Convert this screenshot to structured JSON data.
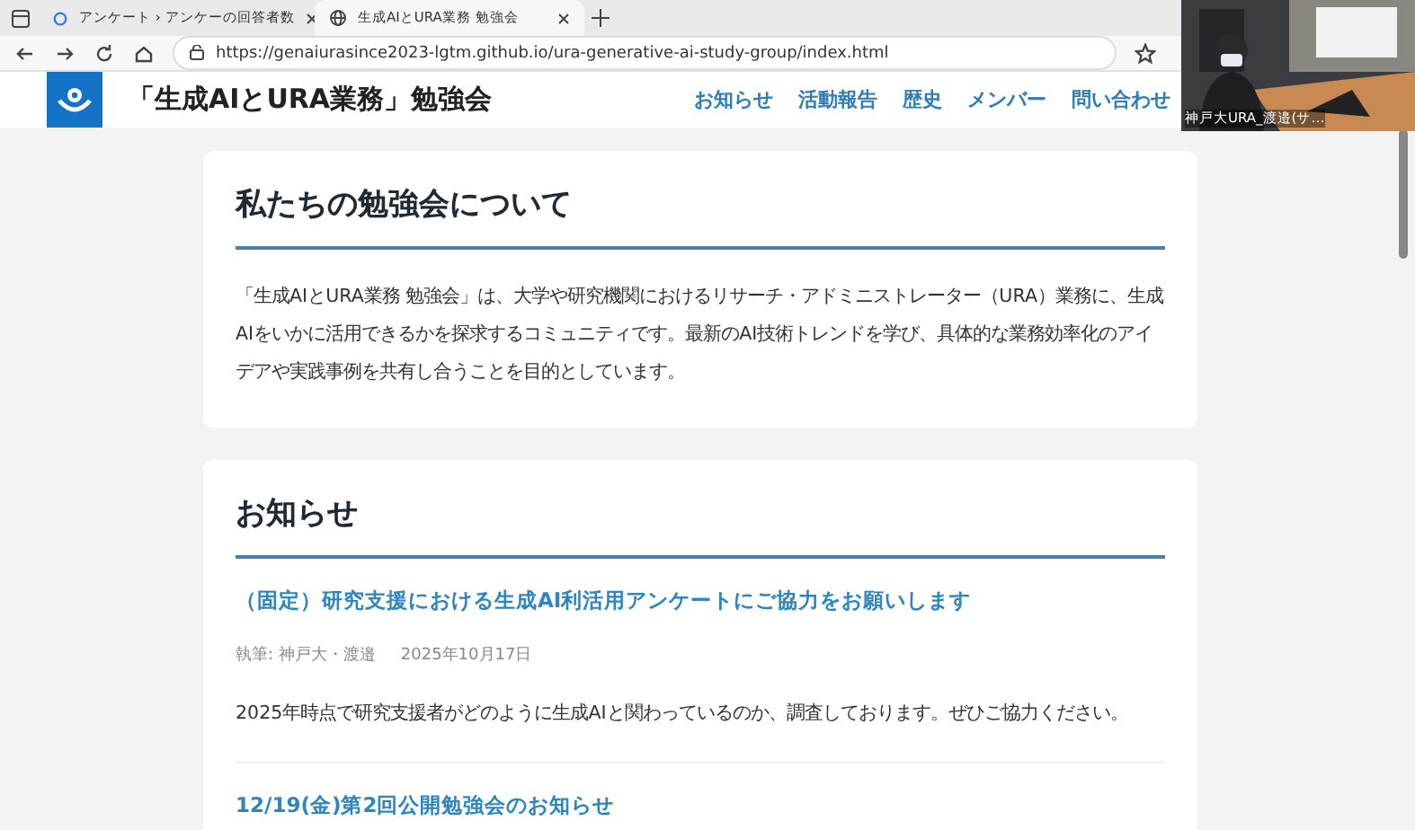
{
  "browser": {
    "tabs": [
      {
        "title": "アンケート › アンケーの回答者数",
        "selected": false
      },
      {
        "title": "生成AIとURA業務 勉強会",
        "selected": true
      }
    ],
    "url": "https://genaiurasince2023-lgtm.github.io/ura-generative-ai-study-group/index.html"
  },
  "site": {
    "title": "「生成AIとURA業務」勉強会",
    "nav": [
      {
        "label": "お知らせ"
      },
      {
        "label": "活動報告"
      },
      {
        "label": "歴史"
      },
      {
        "label": "メンバー"
      },
      {
        "label": "問い合わせ"
      }
    ]
  },
  "about": {
    "heading": "私たちの勉強会について",
    "body": "「生成AIとURA業務 勉強会」は、大学や研究機関におけるリサーチ・アドミニストレーター（URA）業務に、生成AIをいかに活用できるかを探求するコミュニティです。最新のAI技術トレンドを学び、具体的な業務効率化のアイデアや実践事例を共有し合うことを目的としています。"
  },
  "news": {
    "heading": "お知らせ",
    "posts": [
      {
        "title": "（固定）研究支援における生成AI利活用アンケートにご協力をお願いします",
        "author": "執筆: 神戸大・渡邉",
        "date": "2025年10月17日",
        "body": "2025年時点で研究支援者がどのように生成AIと関わっているのか、調査しております。ぜひご協力ください。"
      },
      {
        "title": "12/19(金)第2回公開勉強会のお知らせ"
      }
    ]
  },
  "video_overlay": {
    "kind": "picture",
    "caption": "神戸大URA_渡邉(サ…"
  }
}
